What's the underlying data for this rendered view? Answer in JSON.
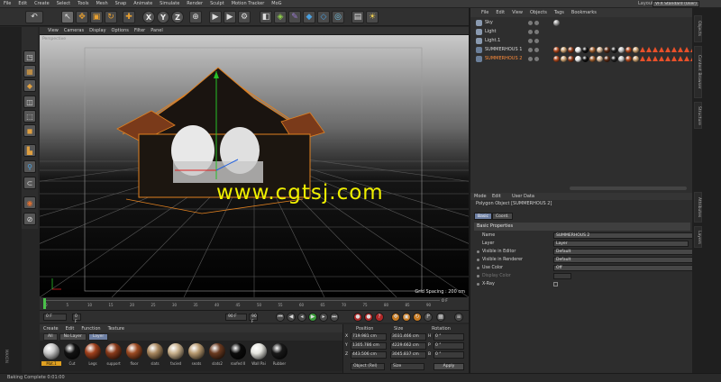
{
  "menubar": {
    "items": [
      "File",
      "Edit",
      "Create",
      "Select",
      "Tools",
      "Mesh",
      "Snap",
      "Animate",
      "Simulate",
      "Render",
      "Sculpt",
      "Motion Tracker",
      "MoG"
    ],
    "layout_label": "Layout:",
    "layout_value": "VFX Standard (User)"
  },
  "viewport": {
    "menu": [
      "View",
      "Cameras",
      "Display",
      "Options",
      "Filter",
      "Panel"
    ],
    "camera_label": "Perspective",
    "grid_spacing": "Grid Spacing : 200 cm",
    "watermark": "www.cgtsj.com"
  },
  "timeline": {
    "ticks": [
      "0",
      "5",
      "10",
      "15",
      "20",
      "25",
      "30",
      "35",
      "40",
      "45",
      "50",
      "55",
      "60",
      "65",
      "70",
      "75",
      "80",
      "85",
      "90"
    ],
    "end_label": "0 F",
    "current_frame": "0 F",
    "start_frame": "0 F",
    "end_frame": "90 F",
    "end_frame2": "90 F"
  },
  "material_manager": {
    "menu": [
      "Create",
      "Edit",
      "Function",
      "Texture"
    ],
    "tabs": [
      "All",
      "No Layer",
      "Layer"
    ],
    "materials": [
      {
        "name": "Mat.1",
        "color": "#c9c9c9"
      },
      {
        "name": "Cut",
        "color": "#111111"
      },
      {
        "name": "Legs",
        "color": "#a0401c"
      },
      {
        "name": "support",
        "color": "#8a3a1a"
      },
      {
        "name": "floor",
        "color": "#9c4a22"
      },
      {
        "name": "slats",
        "color": "#a8875e"
      },
      {
        "name": "facied",
        "color": "#c8b08c"
      },
      {
        "name": "seats",
        "color": "#b89a70"
      },
      {
        "name": "slats2",
        "color": "#6a3a20"
      },
      {
        "name": "roofed II",
        "color": "#0b0b0b"
      },
      {
        "name": "Wall Pai",
        "color": "#e6e6e0"
      },
      {
        "name": "Rubber",
        "color": "#181818"
      }
    ]
  },
  "coordinates": {
    "headers": [
      "Position",
      "Size",
      "Rotation"
    ],
    "rows": [
      {
        "axis": "X",
        "pos": "719.981 cm",
        "size": "3031.466 cm",
        "rot_axis": "H",
        "rot": "0 °"
      },
      {
        "axis": "Y",
        "pos": "1305.786 cm",
        "size": "4229.662 cm",
        "rot_axis": "P",
        "rot": "0 °"
      },
      {
        "axis": "Z",
        "pos": "443.506 cm",
        "size": "3045.837 cm",
        "rot_axis": "B",
        "rot": "0 °"
      }
    ],
    "mode_select": "Object (Rel)",
    "size_select": "Size",
    "apply_label": "Apply"
  },
  "status": "Baking Complete  0:01:00",
  "object_manager": {
    "menu": [
      "File",
      "Edit",
      "View",
      "Objects",
      "Tags",
      "Bookmarks"
    ],
    "objects": [
      {
        "name": "Sky",
        "selected": false
      },
      {
        "name": "Light",
        "selected": false
      },
      {
        "name": "Light.1",
        "selected": false
      },
      {
        "name": "SUMMERHOUS 1",
        "selected": false
      },
      {
        "name": "SUMMERHOUS 2",
        "selected": true
      }
    ]
  },
  "attributes": {
    "menu": [
      "Mode",
      "Edit",
      "User Data"
    ],
    "title": "Polygon Object [SUMMERHOUS 2]",
    "tabs": [
      "Basic",
      "Coord."
    ],
    "section": "Basic Properties",
    "rows": [
      {
        "label": "Name",
        "value": "SUMMERHOUS 2"
      },
      {
        "label": "Layer",
        "value": "Layer"
      },
      {
        "label": "Visible in Editor",
        "value": "Default"
      },
      {
        "label": "Visible in Renderer",
        "value": "Default"
      },
      {
        "label": "Use Color",
        "value": "Off"
      },
      {
        "label": "Display Color",
        "value": ""
      },
      {
        "label": "X-Ray",
        "value": ""
      }
    ]
  },
  "right_tabs": [
    "Objects",
    "Content Browser",
    "Structure",
    "Attributes",
    "Layers"
  ],
  "colors": {
    "accent": "#ff8c3a",
    "selection": "#6d7fa3",
    "watermark": "#f0f000"
  }
}
